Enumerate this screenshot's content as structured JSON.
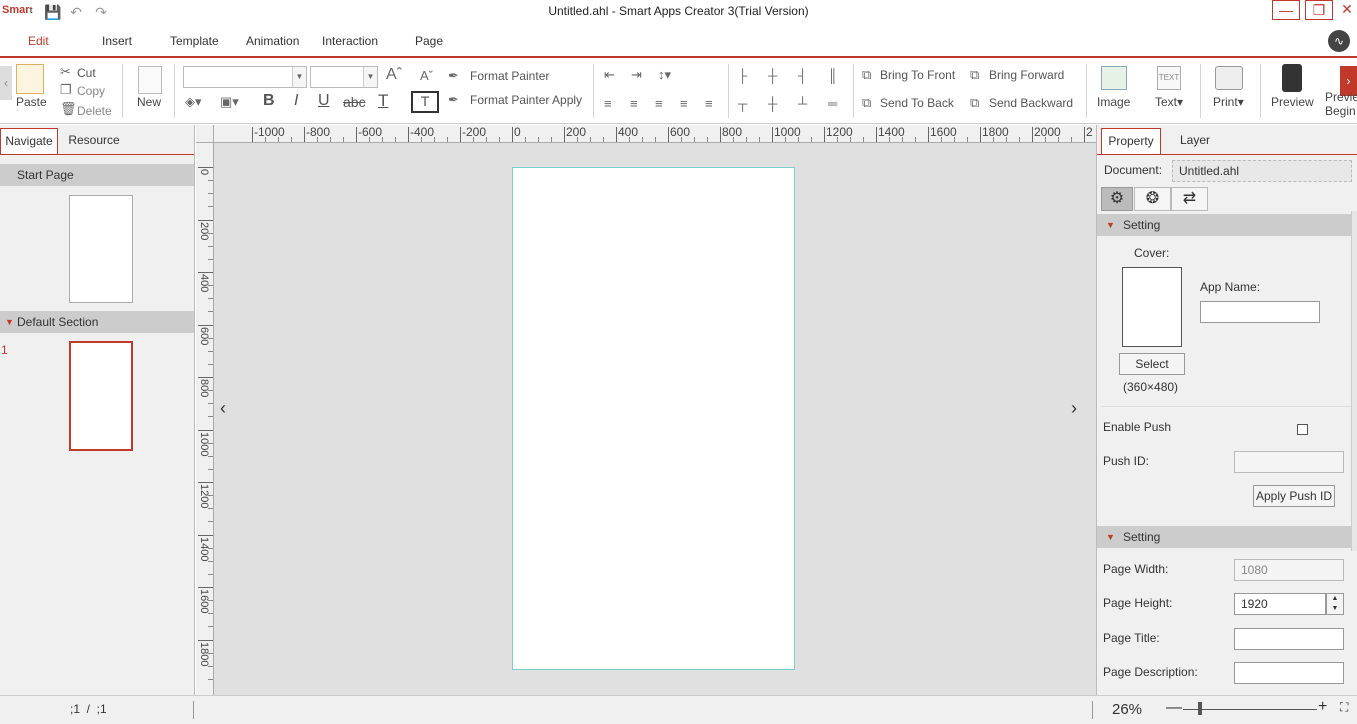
{
  "window": {
    "title": "Untitled.ahl - Smart Apps Creator 3(Trial Version)",
    "logo_main": "Smar",
    "logo_sub": "t"
  },
  "menu": {
    "tabs": [
      "Edit",
      "Insert",
      "Template",
      "Animation",
      "Interaction",
      "Page"
    ]
  },
  "ribbon": {
    "paste": "Paste",
    "cut": "Cut",
    "copy": "Copy",
    "delete": "Delete",
    "new": "New",
    "format_painter": "Format Painter",
    "format_painter_apply": "Format Painter Apply",
    "bring_to_front": "Bring To Front",
    "bring_forward": "Bring Forward",
    "send_to_back": "Send To Back",
    "send_backward": "Send Backward",
    "image": "Image",
    "text": "Text",
    "print": "Print",
    "preview": "Preview",
    "preview_begin_1": "Previe",
    "preview_begin_2": "Begin",
    "bold": "B",
    "italic": "I",
    "underline": "U",
    "strike": "abc",
    "fontcolor": "T"
  },
  "left_panel": {
    "tabs": [
      "Navigate",
      "Resource"
    ],
    "start_page": "Start Page",
    "default_section": "Default Section",
    "page_number": "1"
  },
  "ruler": {
    "h_labels": [
      "-1000",
      "-800",
      "-600",
      "-400",
      "-200",
      "0",
      "200",
      "400",
      "600",
      "800",
      "1000",
      "1200",
      "1400",
      "1600",
      "1800",
      "2000",
      "2"
    ],
    "v_labels": [
      "0",
      "200",
      "400",
      "600",
      "800",
      "1000",
      "1200",
      "1400",
      "1600",
      "1800"
    ]
  },
  "right_panel": {
    "tabs": [
      "Property",
      "Layer"
    ],
    "document_label": "Document:",
    "document_value": "Untitled.ahl",
    "setting1": "Setting",
    "cover_label": "Cover:",
    "app_name_label": "App Name:",
    "app_name_value": "",
    "select_button": "Select",
    "cover_size": "(360×480)",
    "enable_push": "Enable Push",
    "push_id_label": "Push ID:",
    "push_id_value": "",
    "apply_push_id": "Apply Push ID",
    "setting2": "Setting",
    "page_width_label": "Page Width:",
    "page_width_value": "1080",
    "page_height_label": "Page Height:",
    "page_height_value": "1920",
    "page_title_label": "Page Title:",
    "page_title_value": "",
    "page_description_label": "Page Description:",
    "page_description_value": ""
  },
  "status": {
    "page_indicator": ";1  /  ;1",
    "zoom": "26%",
    "zoom_fraction": 0.26
  },
  "colors": {
    "accent": "#c0392b",
    "page_border": "#7ccfcc"
  }
}
